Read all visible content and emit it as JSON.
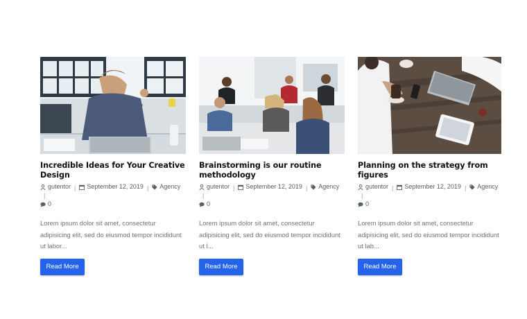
{
  "posts": [
    {
      "title": "Incredible Ideas for Your Creative Design",
      "author": "gutentor",
      "date": "September 12, 2019",
      "category": "Agency",
      "comments": "0",
      "excerpt": "Lorem ipsum dolor sit amet, consectetur adipisicing elit, sed do eiusmod tempor incididunt ut labor...",
      "button": "Read More"
    },
    {
      "title": "Brainstorming is our routine methodology",
      "author": "gutentor",
      "date": "September 12, 2019",
      "category": "Agency",
      "comments": "0",
      "excerpt": "Lorem ipsum dolor sit amet, consectetur adipisicing elit, sed do eiusmod tempor incididunt ut l...",
      "button": "Read More"
    },
    {
      "title": "Planning on the strategy from figures",
      "author": "gutentor",
      "date": "September 12, 2019",
      "category": "Agency",
      "comments": "0",
      "excerpt": "Lorem ipsum dolor sit amet, consectetur adipisicing elit, sed do eiusmod tempor incididunt ut lab...",
      "button": "Read More"
    }
  ],
  "icons": {
    "author": "user-icon",
    "date": "calendar-icon",
    "category": "tag-icon",
    "comments": "comment-icon"
  },
  "colors": {
    "button": "#2563eb",
    "title": "#111111",
    "meta": "#55606b",
    "excerpt": "#6e7378"
  }
}
